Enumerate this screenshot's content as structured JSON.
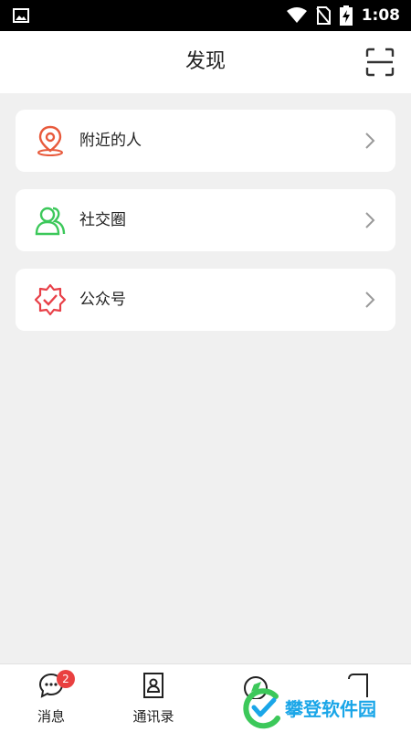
{
  "status_bar": {
    "time": "1:08"
  },
  "header": {
    "title": "发现"
  },
  "menu": [
    {
      "label": "附近的人",
      "icon": "location-pin-icon",
      "color": "#e85a3c"
    },
    {
      "label": "社交圈",
      "icon": "friends-icon",
      "color": "#3cc85a"
    },
    {
      "label": "公众号",
      "icon": "verified-badge-icon",
      "color": "#e84048"
    }
  ],
  "tabbar": {
    "tabs": [
      {
        "label": "消息",
        "icon": "chat-bubble-icon",
        "badge": "2"
      },
      {
        "label": "通讯录",
        "icon": "contacts-icon"
      },
      {
        "label": "",
        "icon": "discover-icon"
      },
      {
        "label": "",
        "icon": "profile-icon"
      }
    ]
  },
  "watermark": {
    "text": "攀登软件园"
  }
}
